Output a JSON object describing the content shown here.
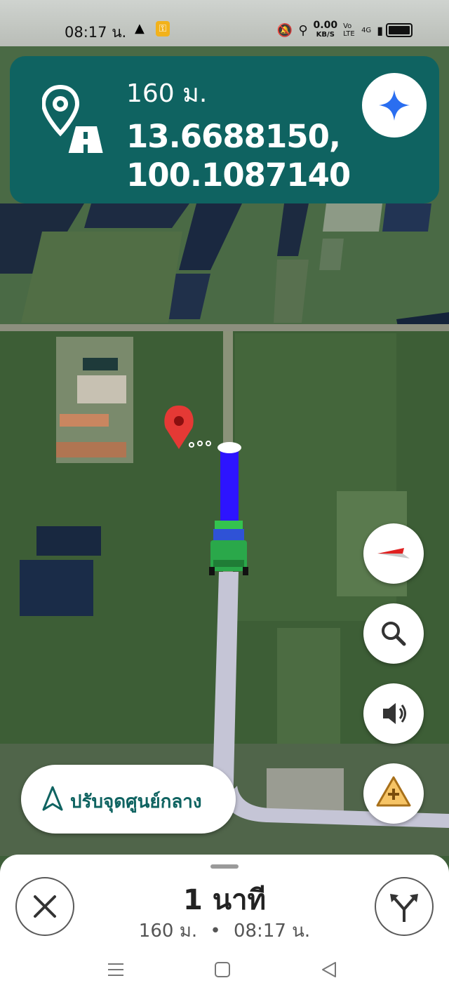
{
  "status_bar": {
    "time": "08:17 น.",
    "net_rate_value": "0.00",
    "net_rate_unit": "KB/S",
    "volte": "Vo LTE",
    "network": "4G"
  },
  "nav_card": {
    "distance": "160 ม.",
    "lat": "13.6688150,",
    "lon": "100.1087140",
    "icon": "pin-road-icon"
  },
  "buttons": {
    "compass": "compass-icon",
    "search": "search-icon",
    "sound": "volume-icon",
    "report": "report-incident-icon",
    "recenter_label": "ปรับจุดศูนย์กลาง"
  },
  "bottom_sheet": {
    "eta": "1 นาที",
    "distance": "160 ม.",
    "separator": "•",
    "arrival_time": "08:17 น."
  },
  "colors": {
    "teal": "#0f6361",
    "route": "#2d14ff",
    "report_orange": "#c98a1a"
  }
}
